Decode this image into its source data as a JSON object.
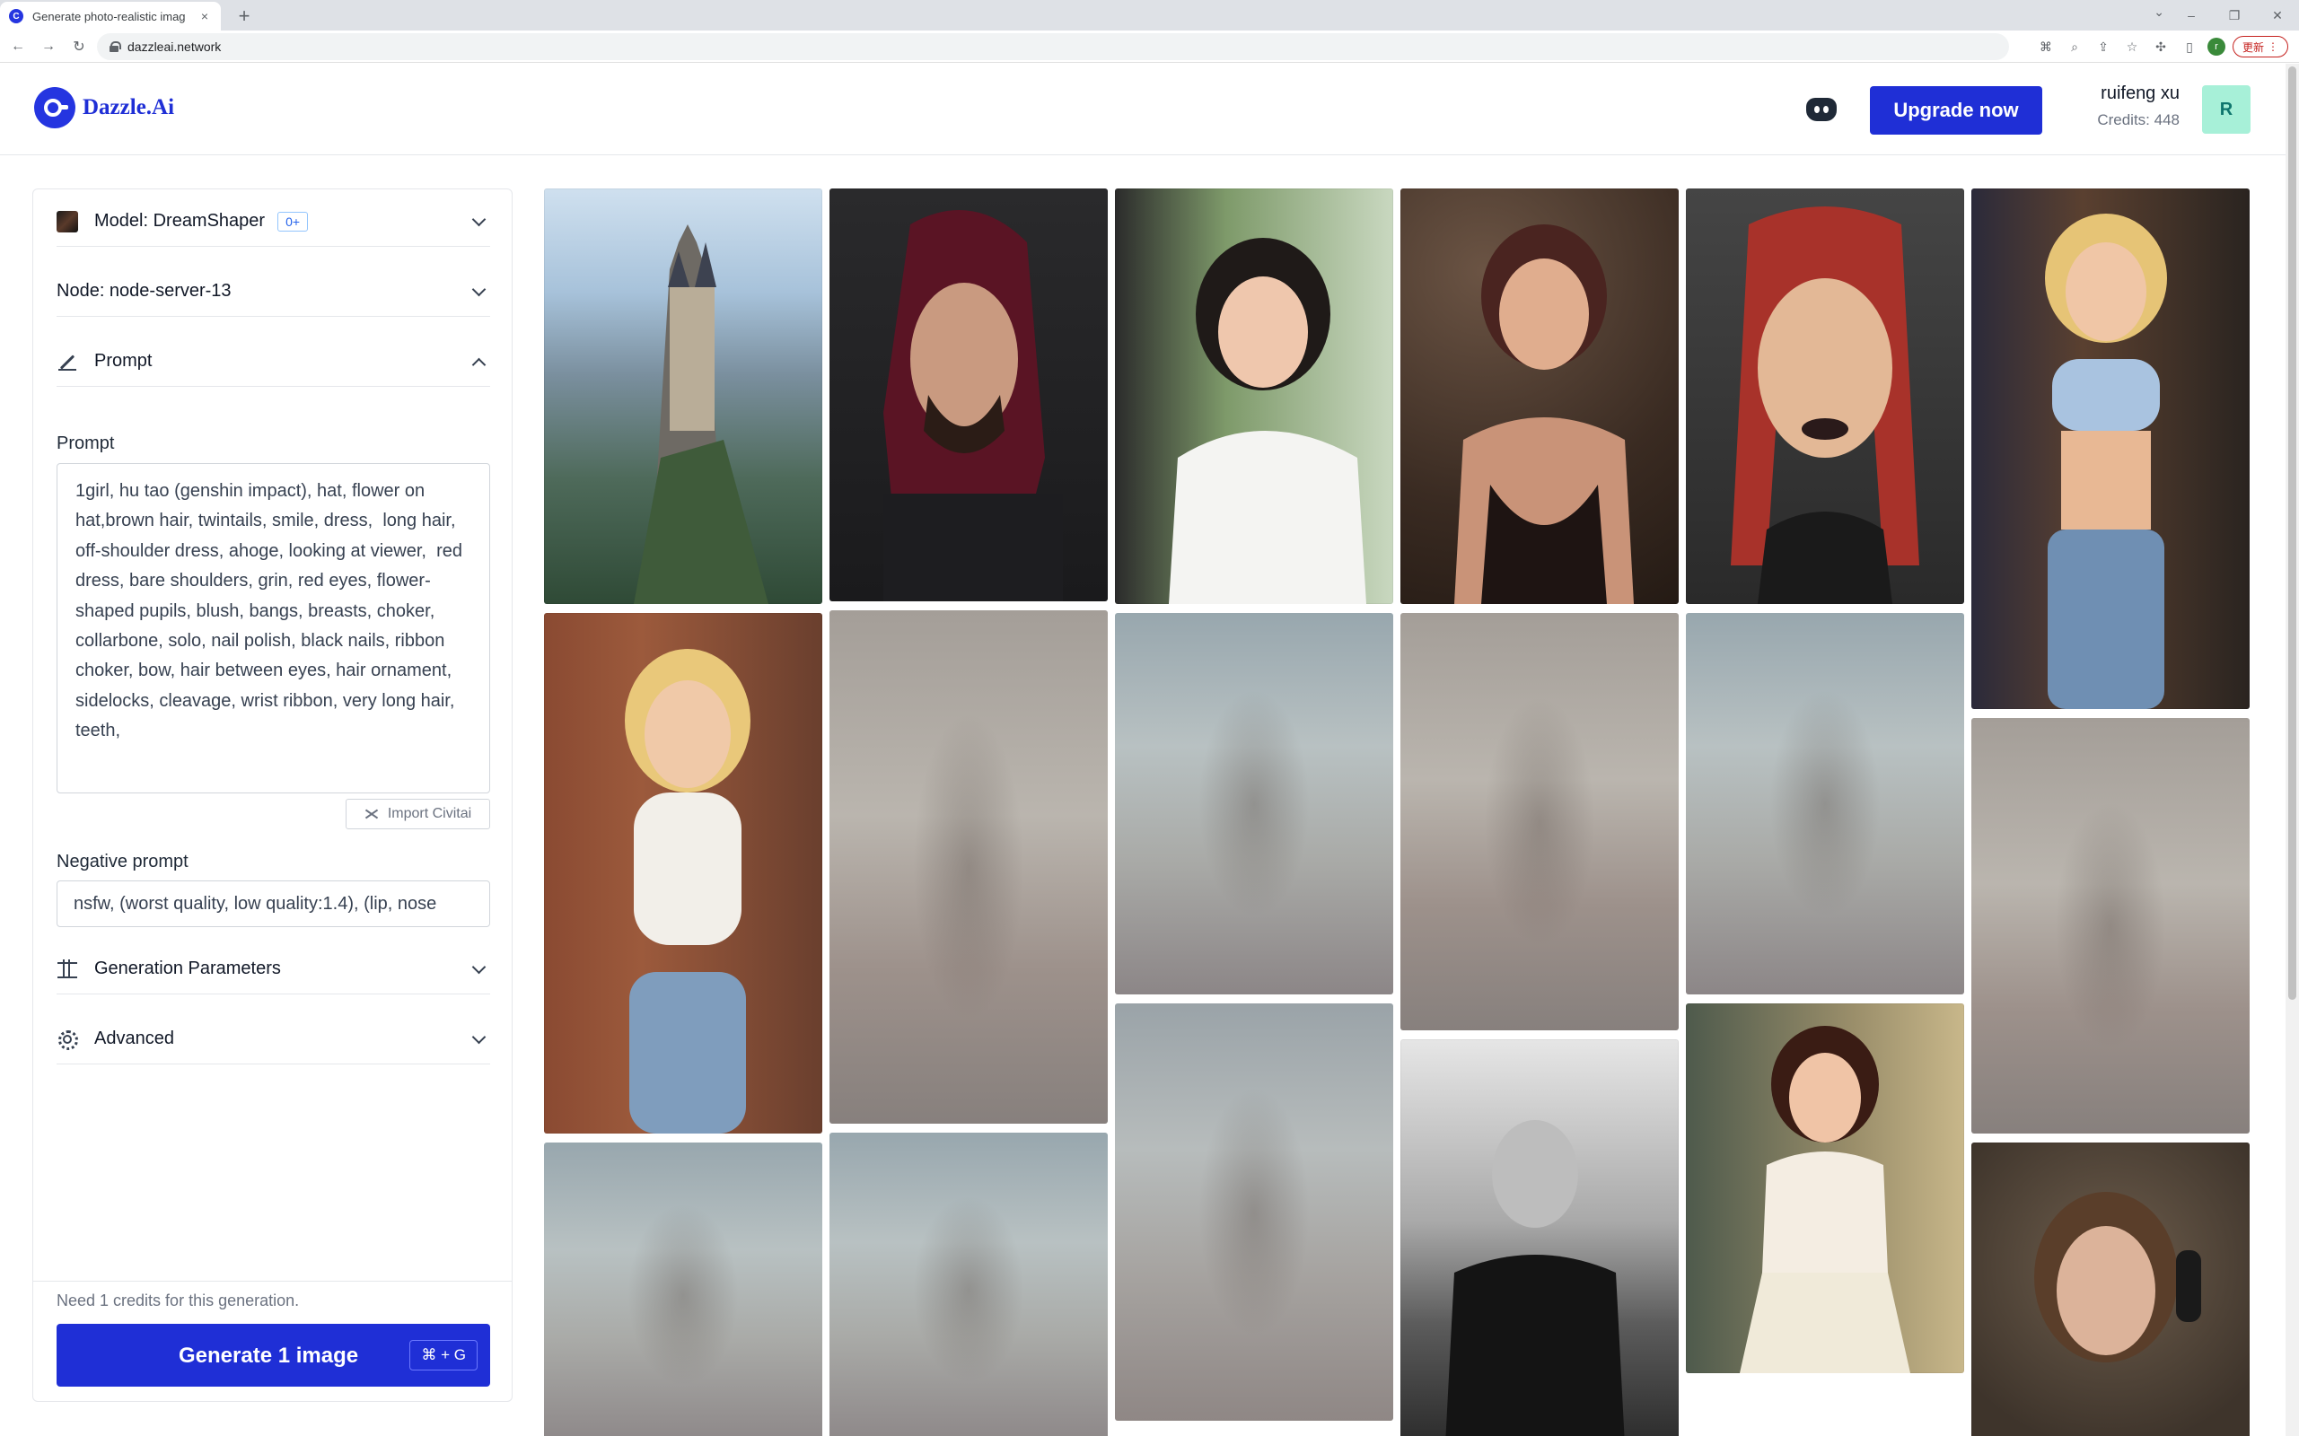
{
  "browser": {
    "tab_title": "Generate photo-realistic imag",
    "tab_close": "×",
    "new_tab": "+",
    "url": "dazzleai.network",
    "update_label": "更新",
    "profile_initial": "r"
  },
  "header": {
    "logo_text": "Dazzle.Ai",
    "upgrade_label": "Upgrade now",
    "user_name": "ruifeng xu",
    "credits": "Credits: 448",
    "avatar_initial": "R"
  },
  "panel": {
    "model_label": "Model: DreamShaper",
    "model_badge": "0+",
    "node_label": "Node: node-server-13",
    "prompt_section": "Prompt",
    "prompt_field_label": "Prompt",
    "prompt_text": "1girl, hu tao (genshin impact), hat, flower on hat,brown hair, twintails, smile, dress,  long hair, off-shoulder dress, ahoge, looking at viewer,  red dress, bare shoulders, grin, red eyes, flower-shaped pupils, blush, bangs, breasts, choker, collarbone, solo, nail polish, black nails, ribbon choker, bow, hair between eyes, hair ornament, sidelocks, cleavage, wrist ribbon, very long hair, teeth,",
    "import_label": "Import Civitai",
    "negative_label": "Negative prompt",
    "negative_value": "nsfw, (worst quality, low quality:1.4), (lip, nose",
    "gen_params_label": "Generation Parameters",
    "advanced_label": "Advanced",
    "credits_note": "Need 1 credits for this generation.",
    "generate_label": "Generate 1 image",
    "shortcut": "⌘ + G"
  },
  "colors": {
    "brand": "#1f2fd6",
    "avatar_bg": "#a7f0d8"
  },
  "gallery": {
    "tiles": [
      {
        "name": "castle-image",
        "kind": "clear"
      },
      {
        "name": "red-haired-man-image",
        "kind": "clear"
      },
      {
        "name": "car-woman-image",
        "kind": "clear"
      },
      {
        "name": "braided-woman-image",
        "kind": "clear"
      },
      {
        "name": "red-hair-portrait-image",
        "kind": "clear"
      },
      {
        "name": "blonde-street-woman-image",
        "kind": "clear"
      },
      {
        "name": "blonde-brick-wall-woman-image",
        "kind": "clear"
      },
      {
        "name": "blurred-image",
        "kind": "blur"
      },
      {
        "name": "blurred-image",
        "kind": "blur"
      },
      {
        "name": "blurred-image",
        "kind": "blur"
      },
      {
        "name": "blurred-image",
        "kind": "blur"
      },
      {
        "name": "blurred-image",
        "kind": "blur"
      },
      {
        "name": "blurred-image",
        "kind": "blur"
      },
      {
        "name": "bald-man-beach-image",
        "kind": "clear"
      },
      {
        "name": "pinup-woman-image",
        "kind": "clear"
      },
      {
        "name": "blurred-image",
        "kind": "blur"
      },
      {
        "name": "blurred-image",
        "kind": "blur"
      },
      {
        "name": "headphones-woman-image",
        "kind": "clear"
      }
    ]
  }
}
